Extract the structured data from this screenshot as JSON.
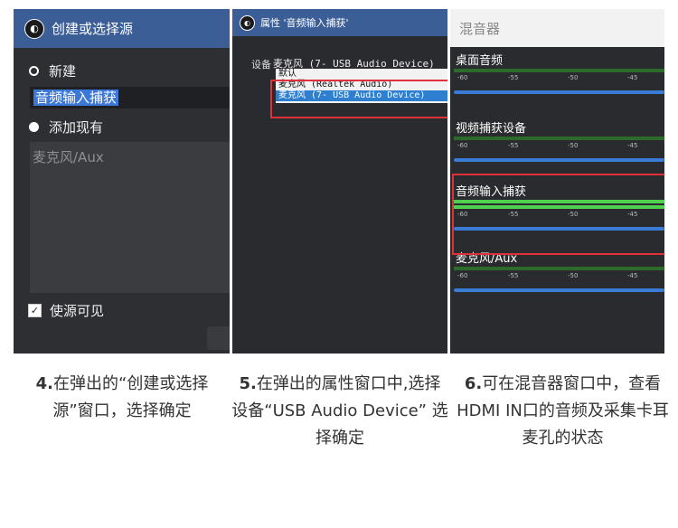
{
  "panel1": {
    "title": "创建或选择源",
    "new_label": "新建",
    "name_value": "音频输入捕获",
    "existing_label": "添加现有",
    "list_items": [
      "麦克风/Aux"
    ],
    "visible_label": "使源可见",
    "logo_icon": "obs-logo-icon"
  },
  "panel2": {
    "title": "属性 '音频输入捕获'",
    "device_label": "设备",
    "device_value": "麦克风 (7- USB Audio Device)",
    "options": [
      "默认",
      "麦克风 (Realtek Audio)",
      "麦克风 (7- USB Audio Device)"
    ],
    "selected_index": 2
  },
  "panel3": {
    "title": "混音器",
    "channels": [
      {
        "name": "桌面音频",
        "level": 1.0
      },
      {
        "name": "视频捕获设备",
        "level": 1.0
      },
      {
        "name": "音频输入捕获",
        "level": 1.0
      },
      {
        "name": "麦克风/Aux",
        "level": 1.0
      }
    ],
    "ticks": [
      "-60",
      "-55",
      "-50",
      "-45"
    ]
  },
  "captions": [
    {
      "num": "4.",
      "text": "在弹出的“创建或选择源”窗口，选择确定"
    },
    {
      "num": "5.",
      "text": "在弹出的属性窗口中,选择设备“USB Audio Device” 选择确定"
    },
    {
      "num": "6.",
      "text": "可在混音器窗口中，查看HDMI IN口的音频及采集卡耳麦孔的状态"
    }
  ],
  "colors": {
    "title_blue": "#3c5e97",
    "highlight_red": "#e0303a",
    "meter_green": "#4fd04f",
    "volume_blue": "#3a7bd5"
  }
}
